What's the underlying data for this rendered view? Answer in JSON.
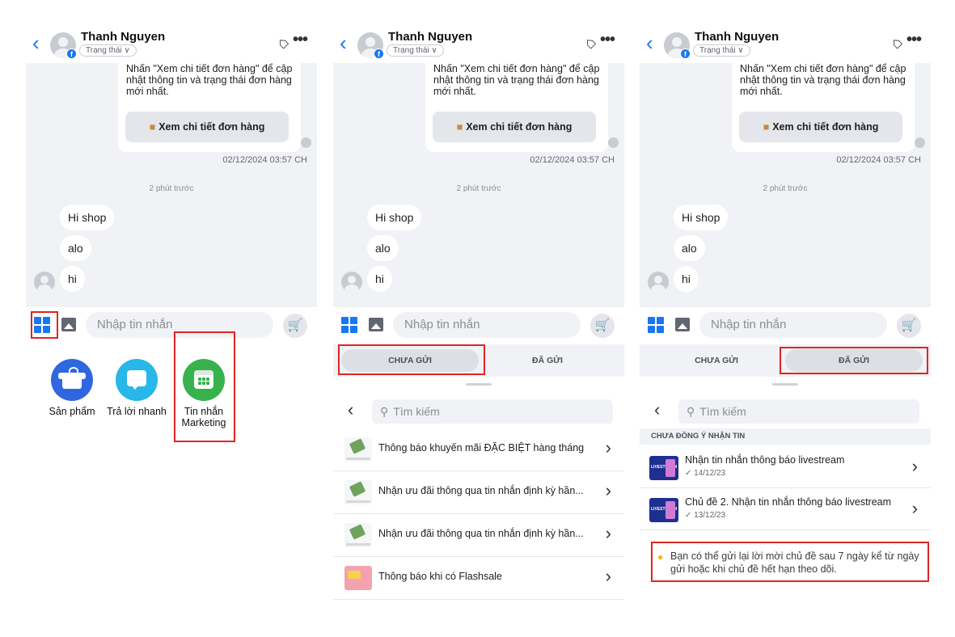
{
  "header": {
    "name": "Thanh Nguyen",
    "status": "Trạng thái ∨",
    "fb_letter": "f"
  },
  "chat": {
    "info_text": "Nhấn \"Xem chi tiết đơn hàng\" để cập nhật thông tin và trạng thái đơn hàng mới nhất.",
    "view_order_button": "Xem chi tiết đơn hàng",
    "timestamp": "02/12/2024 03:57 CH",
    "time_ago": "2 phút trước",
    "messages": [
      "Hi shop",
      "alo",
      "hi"
    ]
  },
  "input": {
    "placeholder": "Nhập tin nhắn"
  },
  "tools": [
    {
      "label": "Sản phẩm"
    },
    {
      "label": "Trả lời nhanh"
    },
    {
      "label": "Tin nhắn Marketing"
    }
  ],
  "tabs": {
    "unsent": "CHƯA GỬI",
    "sent": "ĐÃ GỬI"
  },
  "search": {
    "placeholder": "Tìm kiếm"
  },
  "templates": [
    {
      "label": "Thông báo khuyến mãi ĐẶC BIỆT hàng tháng"
    },
    {
      "label": "Nhận ưu đãi thông qua tin nhắn định kỳ hần..."
    },
    {
      "label": "Nhận ưu đãi thông qua tin nhắn định kỳ hần..."
    },
    {
      "label": "Thông báo khi có Flashsale"
    }
  ],
  "sent_section": {
    "label": "CHƯA ĐỒNG Ý NHẬN TIN",
    "topics": [
      {
        "title": "Nhận tin nhắn thông báo livestream",
        "date": "✓ 14/12/23"
      },
      {
        "title": "Chủ đề 2. Nhận tin nhắn thông báo livestream",
        "date": "✓ 13/12/23"
      }
    ],
    "hint": "Bạn có thể gửi lại lời mời chủ đề sau 7 ngày kể từ ngày gửi hoặc khi chủ đề hết hạn theo dõi."
  },
  "icons": {
    "back": "chevron-left-icon",
    "tag": "tag-icon",
    "more": "more-icon",
    "grid": "grid-icon",
    "image": "image-icon",
    "cart": "cart-icon",
    "search": "search-icon",
    "bulb": "lightbulb-icon"
  },
  "colors": {
    "accent": "#1877f2",
    "highlight": "#e02424",
    "chat_bg": "#f0f2f5"
  }
}
